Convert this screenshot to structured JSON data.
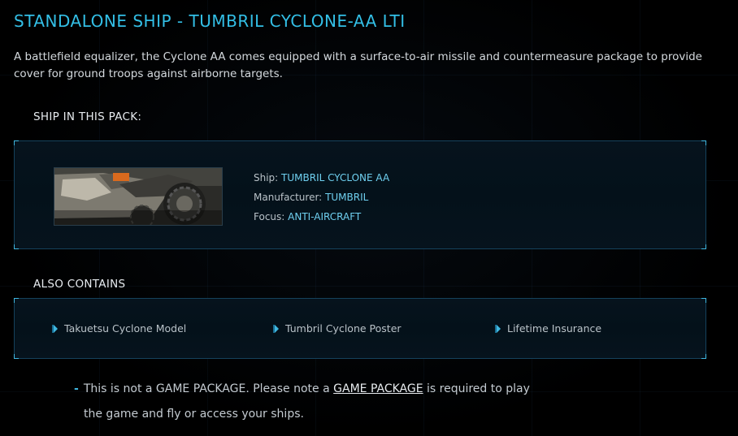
{
  "title": "STANDALONE SHIP - TUMBRIL CYCLONE-AA LTI",
  "description": "A battlefield equalizer, the Cyclone AA comes equipped with a surface-to-air missile and countermeasure package to provide cover for ground troops against airborne targets.",
  "ship_section": {
    "label": "SHIP IN THIS PACK:",
    "ship_label": "Ship:",
    "ship_value": "TUMBRIL CYCLONE AA",
    "manufacturer_label": "Manufacturer:",
    "manufacturer_value": "TUMBRIL",
    "focus_label": "Focus:",
    "focus_value": "ANTI-AIRCRAFT"
  },
  "also_section": {
    "label": "ALSO CONTAINS",
    "items": [
      {
        "label": "Takuetsu Cyclone Model"
      },
      {
        "label": "Tumbril Cyclone Poster"
      },
      {
        "label": "Lifetime Insurance"
      }
    ]
  },
  "note": {
    "prefix": "This is not a GAME PACKAGE. Please note a",
    "link": "GAME PACKAGE",
    "suffix": "is required to play",
    "line2": "the game and fly or access your ships."
  },
  "colors": {
    "accent": "#33bfe6",
    "background": "#000000",
    "panel_border": "#15425c"
  }
}
